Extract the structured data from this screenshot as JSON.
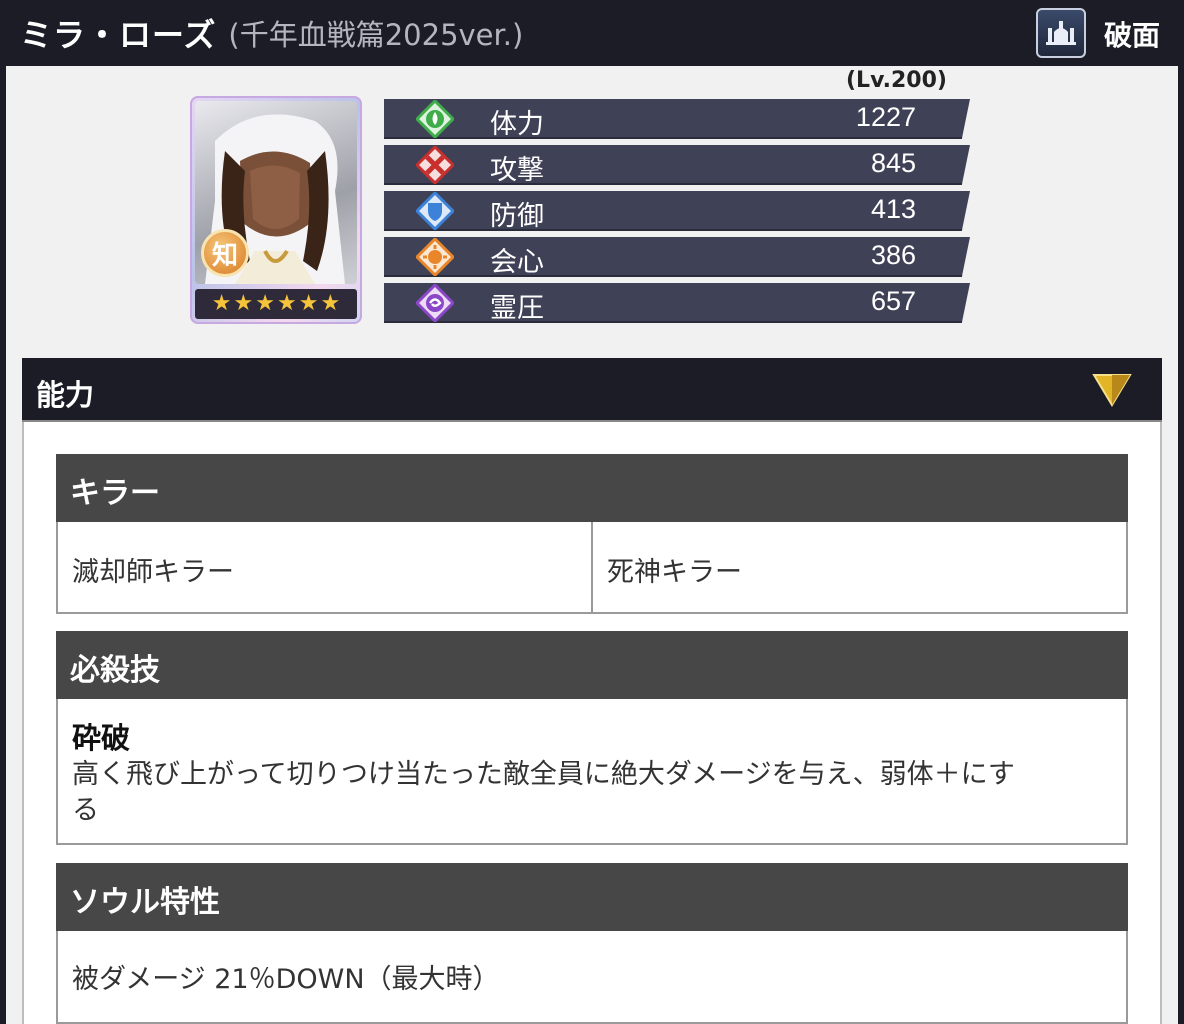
{
  "header": {
    "name": "ミラ・ローズ",
    "subtitle": "(千年血戦篇2025ver.)",
    "attribute_icon": "attribute-icon",
    "attribute_label": "破面"
  },
  "portrait": {
    "badge": "知",
    "stars": 6
  },
  "stats": {
    "level": "(Lv.200)",
    "rows": [
      {
        "label": "体力",
        "value": "1227",
        "icon": "hp-icon",
        "color": "#3fae4a"
      },
      {
        "label": "攻撃",
        "value": "845",
        "icon": "attack-icon",
        "color": "#c8302e"
      },
      {
        "label": "防御",
        "value": "413",
        "icon": "defense-icon",
        "color": "#3b82d8"
      },
      {
        "label": "会心",
        "value": "386",
        "icon": "critical-icon",
        "color": "#e9862a"
      },
      {
        "label": "霊圧",
        "value": "657",
        "icon": "spirit-icon",
        "color": "#8c46c8"
      }
    ]
  },
  "ability": {
    "title": "能力",
    "killer": {
      "header": "キラー",
      "items": [
        "滅却師キラー",
        "死神キラー"
      ]
    },
    "special": {
      "header": "必殺技",
      "name": "砕破",
      "desc_line1": "高く飛び上がって切りつけ当たった敵全員に絶大ダメージを与え、弱体＋にす",
      "desc_line2": "る"
    },
    "soul": {
      "header": "ソウル特性",
      "text": "被ダメージ 21％DOWN（最大時）"
    }
  },
  "colors": {
    "header_bg": "#1b1c26",
    "stat_bg": "#3f4156",
    "section_bg": "#474747",
    "toggle_gold": "#e2b526"
  }
}
